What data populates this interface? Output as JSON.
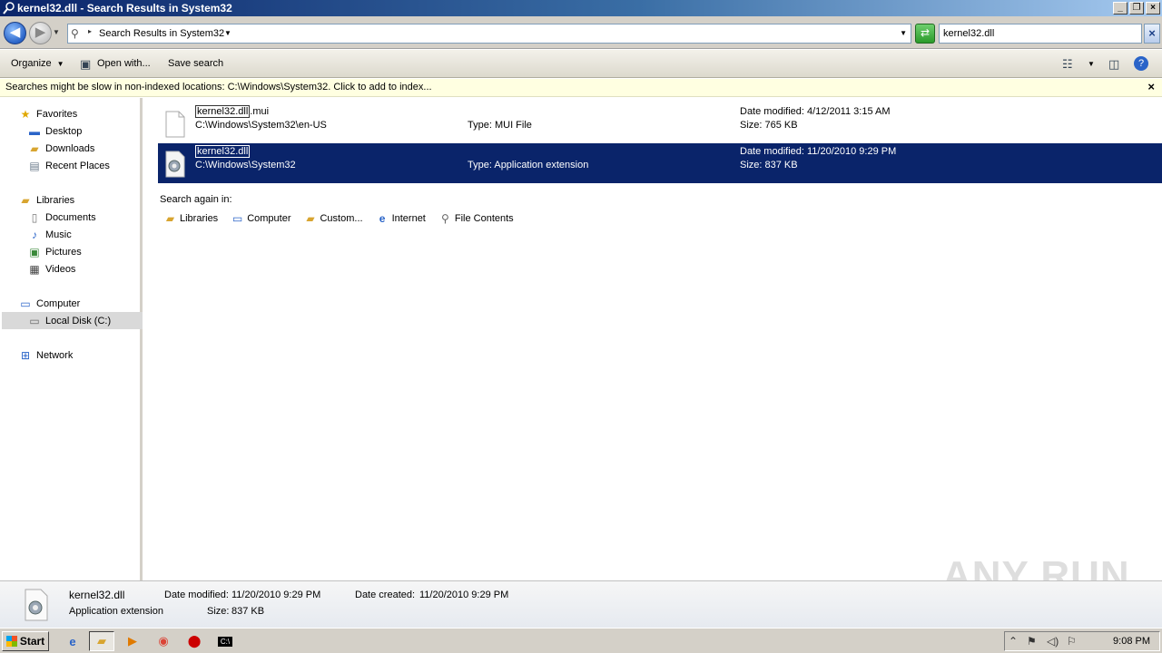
{
  "window": {
    "title": "kernel32.dll - Search Results in System32"
  },
  "address": {
    "crumb": "Search Results in System32"
  },
  "search": {
    "value": "kernel32.dll"
  },
  "toolbar": {
    "organize": "Organize",
    "open_with": "Open with...",
    "save_search": "Save search"
  },
  "infobar": {
    "message": "Searches might be slow in non-indexed locations: C:\\Windows\\System32. Click to add to index..."
  },
  "nav": {
    "favorites": "Favorites",
    "desktop": "Desktop",
    "downloads": "Downloads",
    "recent": "Recent Places",
    "libraries": "Libraries",
    "documents": "Documents",
    "music": "Music",
    "pictures": "Pictures",
    "videos": "Videos",
    "computer": "Computer",
    "local_disk": "Local Disk (C:)",
    "network": "Network"
  },
  "results": [
    {
      "name_match": "kernel32.dll",
      "name_rest": ".mui",
      "path": "C:\\Windows\\System32\\en-US",
      "type": "Type: MUI File",
      "modified": "Date modified: 4/12/2011 3:15 AM",
      "size": "Size: 765 KB"
    },
    {
      "name_match": "kernel32.dll",
      "name_rest": "",
      "path": "C:\\Windows\\System32",
      "type": "Type: Application extension",
      "modified": "Date modified: 11/20/2010 9:29 PM",
      "size": "Size: 837 KB"
    }
  ],
  "search_again": {
    "label": "Search again in:",
    "libraries": "Libraries",
    "computer": "Computer",
    "custom": "Custom...",
    "internet": "Internet",
    "file_contents": "File Contents"
  },
  "details": {
    "name": "kernel32.dll",
    "type": "Application extension",
    "modified_label": "Date modified:",
    "modified": "11/20/2010 9:29 PM",
    "size_label": "Size:",
    "size": "837 KB",
    "created_label": "Date created:",
    "created": "11/20/2010 9:29 PM"
  },
  "taskbar": {
    "start": "Start",
    "clock": "9:08 PM"
  },
  "watermark": "ANY RUN"
}
